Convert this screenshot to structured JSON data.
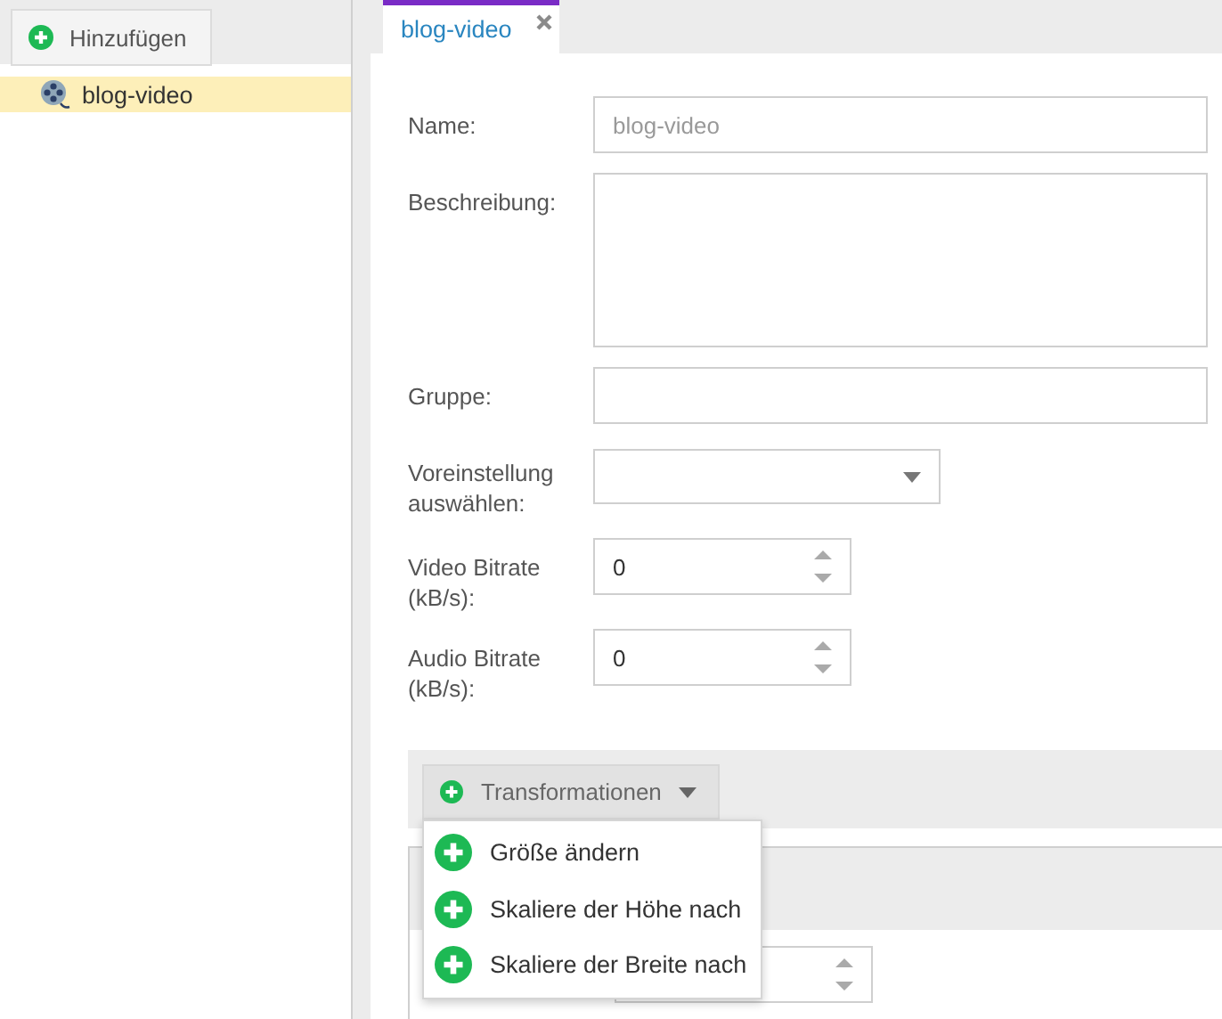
{
  "sidebar": {
    "add_button": "Hinzufügen",
    "items": [
      {
        "label": "blog-video",
        "selected": true
      }
    ]
  },
  "tabs": [
    {
      "label": "blog-video",
      "selected": true,
      "closable": true
    }
  ],
  "form": {
    "fields": [
      {
        "kind": "text",
        "label": "Name:",
        "value": "blog-video",
        "disabled": true
      },
      {
        "kind": "textarea",
        "label": "Beschreibung:"
      },
      {
        "kind": "text",
        "label": "Gruppe:"
      },
      {
        "kind": "select",
        "label": "Voreinstellung auswählen:"
      },
      {
        "kind": "number",
        "label": "Video Bitrate (kB/s):",
        "value": "0"
      },
      {
        "kind": "number",
        "label": "Audio Bitrate (kB/s):",
        "value": "0"
      }
    ]
  },
  "transformations": {
    "button": "Transformationen",
    "menu": [
      {
        "label": "Größe ändern"
      },
      {
        "label": "Skaliere der Höhe nach"
      },
      {
        "label": "Skaliere der Breite nach"
      }
    ]
  }
}
